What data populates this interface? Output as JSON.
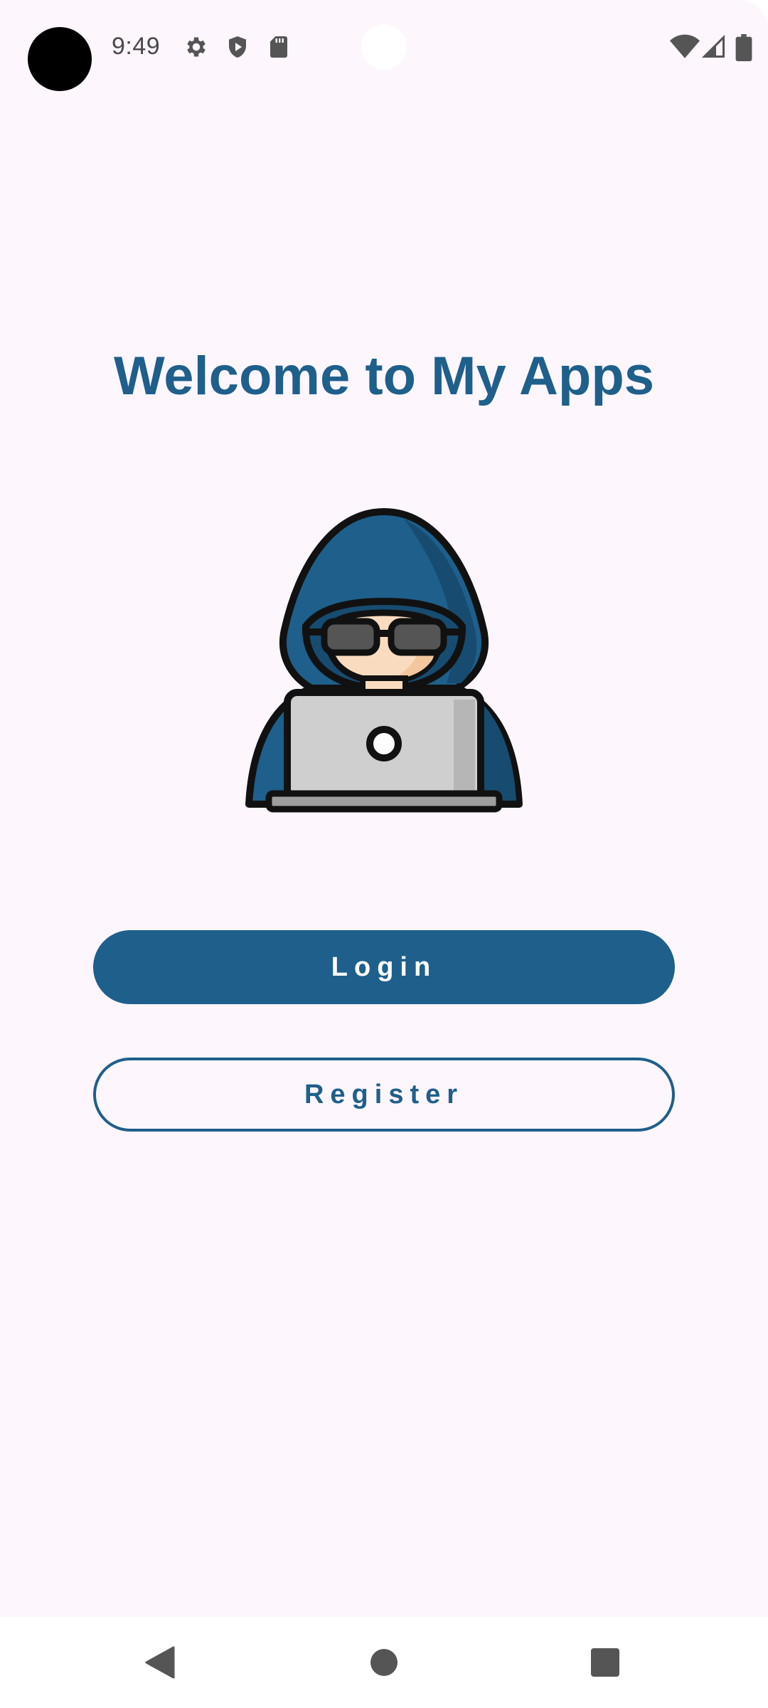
{
  "status_bar": {
    "time": "9:49",
    "icons_left": [
      "settings-icon",
      "shield-play-icon",
      "sd-card-icon"
    ],
    "icons_right": [
      "wifi-icon",
      "cellular-signal-icon",
      "battery-icon"
    ]
  },
  "main": {
    "title": "Welcome to My Apps",
    "illustration": "hooded-hacker-with-laptop",
    "login_label": "Login",
    "register_label": "Register"
  },
  "nav_bar": {
    "buttons": [
      "back-icon",
      "home-icon",
      "recents-icon"
    ]
  },
  "colors": {
    "accent": "#1f5f8b",
    "background": "#fdf6fd",
    "on_accent": "#ffffff"
  }
}
